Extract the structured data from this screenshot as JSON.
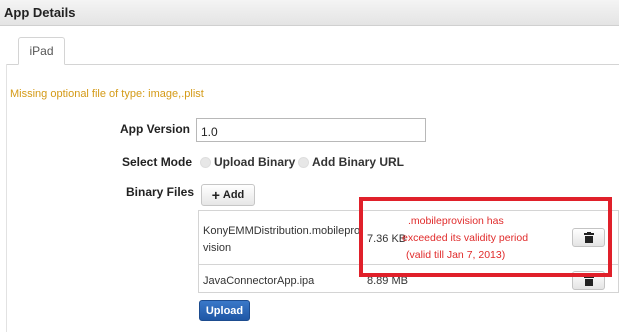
{
  "header": {
    "title": "App Details"
  },
  "tabs": [
    {
      "label": "iPad"
    }
  ],
  "warning": "Missing optional file of type: image,.plist",
  "form": {
    "app_version": {
      "label": "App Version",
      "value": "1.0"
    },
    "select_mode": {
      "label": "Select Mode",
      "options": [
        "Upload Binary",
        "Add Binary URL"
      ]
    },
    "binary_files": {
      "label": "Binary Files",
      "add_label": "Add"
    }
  },
  "files": [
    {
      "name": "KonyEMMDistribution.mobileprovision",
      "size": "7.36 KB",
      "status": [
        ".mobileprovision has",
        "exceeded its validity period",
        "(valid till Jan 7, 2013)"
      ]
    },
    {
      "name": "JavaConnectorApp.ipa",
      "size": "8.89 MB"
    }
  ],
  "upload_label": "Upload",
  "colors": {
    "warning": "#d49a16",
    "error": "#e02a2a",
    "highlight": "#e0202a",
    "primary": "#1f57a5"
  },
  "icons": {
    "add": "plus-icon",
    "delete": "trash-icon"
  }
}
